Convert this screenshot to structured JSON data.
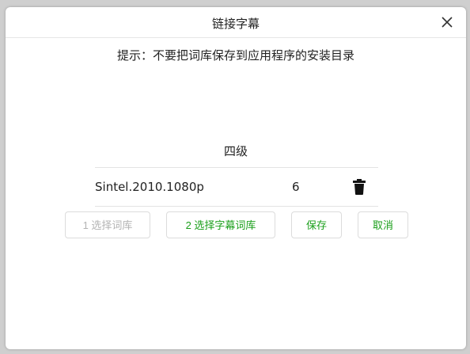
{
  "dialog": {
    "title": "链接字幕",
    "tip": "提示：不要把词库保存到应用程序的安装目录",
    "dictionary": {
      "name": "四级",
      "rows": [
        {
          "name": "Sintel.2010.1080p",
          "count": "6"
        }
      ]
    },
    "buttons": {
      "select_dict": "1 选择词库",
      "select_subtitle": "2 选择字幕词库",
      "save": "保存",
      "cancel": "取消"
    }
  },
  "icons": {
    "close": "close-icon",
    "delete": "trash-icon"
  },
  "colors": {
    "accent": "#1a9f1a",
    "disabled": "#b3b3b3"
  }
}
